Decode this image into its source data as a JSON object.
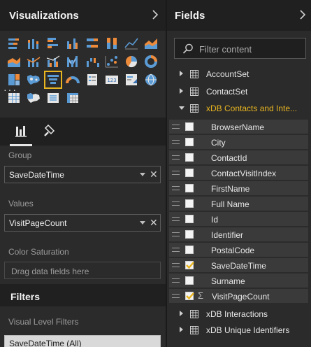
{
  "visualizations": {
    "title": "Visualizations",
    "gallery_icons": [
      "stacked-bar-chart-icon",
      "stacked-column-chart-icon",
      "clustered-bar-chart-icon",
      "clustered-column-chart-icon",
      "100-percent-stacked-bar-icon",
      "100-percent-stacked-column-icon",
      "line-chart-icon",
      "area-chart-icon",
      "stacked-area-chart-icon",
      "line-and-column-chart-icon",
      "line-and-clustered-column-icon",
      "ribbon-chart-icon",
      "waterfall-chart-icon",
      "scatter-chart-icon",
      "pie-chart-icon",
      "donut-chart-icon",
      "treemap-icon",
      "map-icon",
      "filled-map-icon",
      "funnel-icon",
      "gauge-icon",
      "multi-row-card-icon",
      "card-icon",
      "kpi-icon",
      "slicer-icon",
      "table-icon",
      "matrix-icon"
    ],
    "more": "···",
    "wells": {
      "group_label": "Group",
      "group_value": "SaveDateTime",
      "values_label": "Values",
      "values_value": "VisitPageCount",
      "color_saturation_label": "Color Saturation",
      "drop_hint": "Drag data fields here"
    },
    "filters": {
      "title": "Filters",
      "visual_level_label": "Visual Level Filters",
      "chip": "SaveDateTime (All)"
    }
  },
  "fields": {
    "title": "Fields",
    "search_placeholder": "Filter content",
    "tables": [
      {
        "name": "AccountSet"
      },
      {
        "name": "ContactSet"
      },
      {
        "name": "xDB Contacts and Inte..."
      }
    ],
    "columns": [
      {
        "name": "BrowserName",
        "checked": false
      },
      {
        "name": "City",
        "checked": false
      },
      {
        "name": "ContactId",
        "checked": false
      },
      {
        "name": "ContactVisitIndex",
        "checked": false
      },
      {
        "name": "FirstName",
        "checked": false
      },
      {
        "name": "Full Name",
        "checked": false
      },
      {
        "name": "Id",
        "checked": false
      },
      {
        "name": "Identifier",
        "checked": false
      },
      {
        "name": "PostalCode",
        "checked": false
      },
      {
        "name": "SaveDateTime",
        "checked": true
      },
      {
        "name": "Surname",
        "checked": false
      },
      {
        "name": "VisitPageCount",
        "checked": true,
        "sigma": "Σ"
      }
    ],
    "tables_after": [
      {
        "name": "xDB Interactions"
      },
      {
        "name": "xDB Unique Identifiers"
      }
    ]
  },
  "colors": {
    "accent": "#e8b520",
    "panel": "#2b2b2b",
    "header": "#202020"
  }
}
